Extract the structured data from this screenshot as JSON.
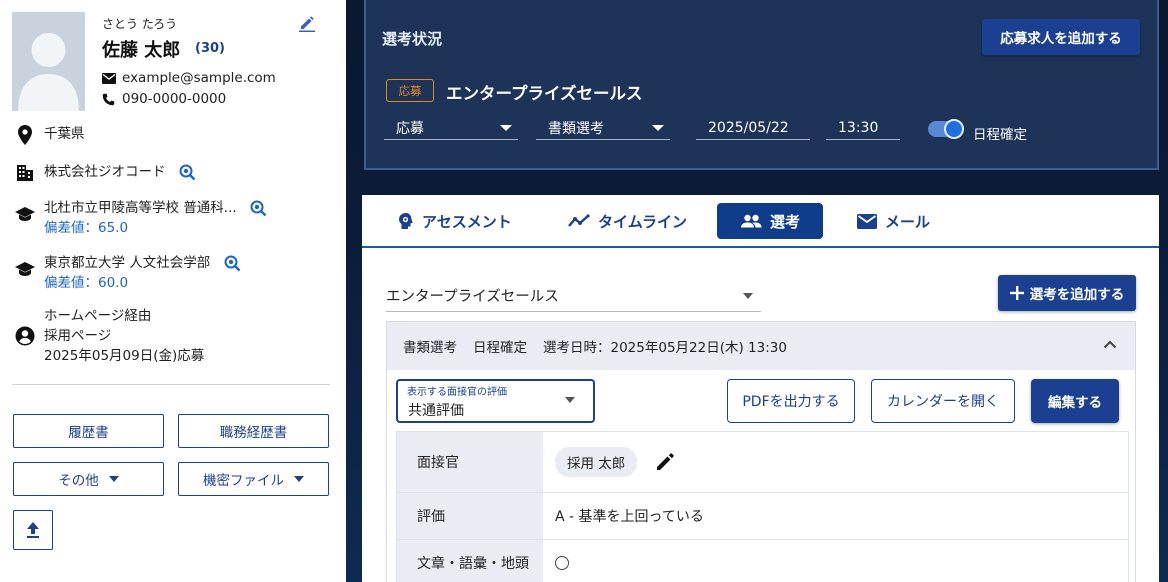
{
  "profile": {
    "kana": "さとう たろう",
    "name": "佐藤 太郎",
    "age": "(30)",
    "email": "example@sample.com",
    "phone": "090-0000-0000",
    "prefecture": "千葉県",
    "company": "株式会社ジオコード",
    "school1": "北杜市立甲陵高等学校 普通科...",
    "school1_score": "偏差値：65.0",
    "school2": "東京都立大学 人文社会学部",
    "school2_score": "偏差値：60.0",
    "source_line1": "ホームページ経由",
    "source_line2": "採用ページ",
    "source_line3": "2025年05月09日(金)応募"
  },
  "docs": {
    "resume": "履歴書",
    "career": "職務経歴書",
    "other": "その他",
    "confidential": "機密ファイル"
  },
  "status": {
    "title": "選考状況",
    "add_job_button": "応募求人を追加する",
    "badge": "応募",
    "job_title": "エンタープライズセールス",
    "stage": "応募",
    "step": "書類選考",
    "date": "2025/05/22",
    "time": "13:30",
    "schedule_label": "日程確定",
    "schedule_confirmed": true
  },
  "tabs": [
    {
      "label": "アセスメント",
      "icon": "brain-icon"
    },
    {
      "label": "タイムライン",
      "icon": "timeline-icon"
    },
    {
      "label": "選考",
      "icon": "group-icon",
      "active": true
    },
    {
      "label": "メール",
      "icon": "mail-icon"
    }
  ],
  "selection": {
    "job_select": "エンタープライズセールス",
    "add_button": "選考を追加する",
    "header_stage": "書類選考",
    "header_status": "日程確定",
    "header_datetime": "選考日時：2025年05月22日(木) 13:30",
    "eval_label": "表示する面接官の評価",
    "eval_value": "共通評価",
    "pdf_button": "PDFを出力する",
    "calendar_button": "カレンダーを開く",
    "edit_button": "編集する",
    "rows": {
      "interviewer_label": "面接官",
      "interviewer_name": "採用 太郎",
      "rating_label": "評価",
      "rating_value": "A - 基準を上回っている",
      "writing_label": "文章・語彙・地頭"
    }
  },
  "colors": {
    "primary": "#1b3f91",
    "accent_blue": "#1b66c9",
    "badge_orange": "#e08a1e",
    "dark_bg": "#0b1c3a"
  }
}
